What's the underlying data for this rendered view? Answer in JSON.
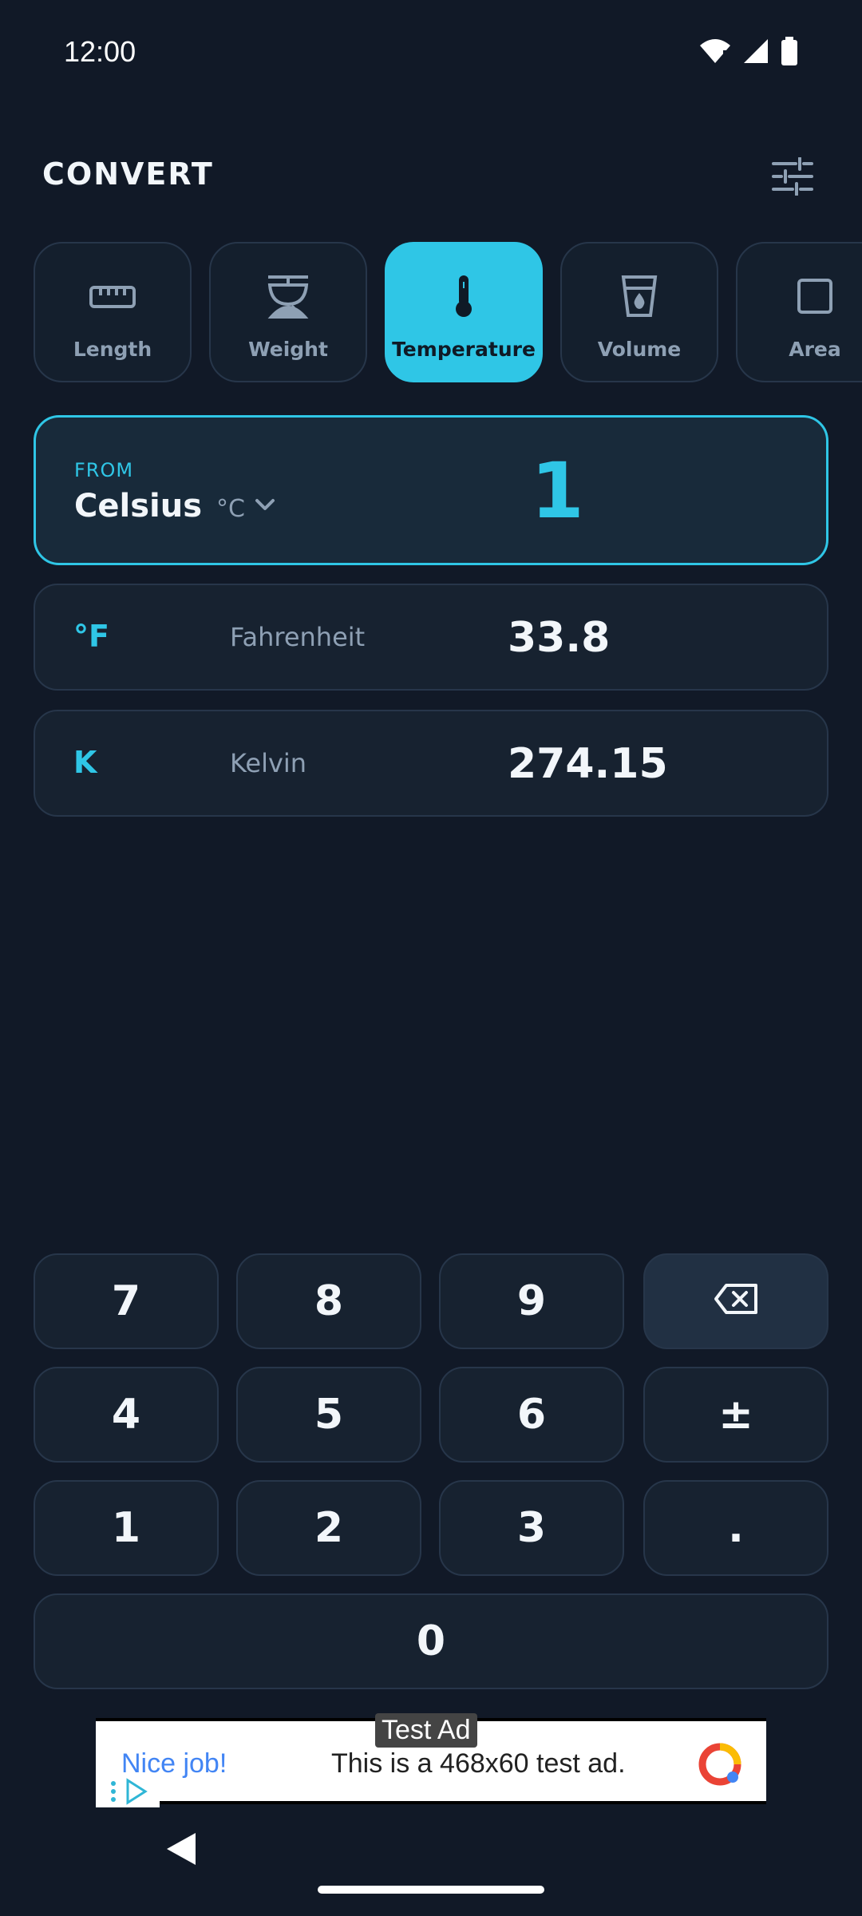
{
  "status_bar": {
    "time": "12:00"
  },
  "header": {
    "title": "CONVERT"
  },
  "categories": [
    {
      "label": "Length",
      "icon": "ruler-icon"
    },
    {
      "label": "Weight",
      "icon": "scale-icon"
    },
    {
      "label": "Temperature",
      "icon": "thermometer-icon",
      "active": true
    },
    {
      "label": "Volume",
      "icon": "cup-icon"
    },
    {
      "label": "Area",
      "icon": "square-icon"
    }
  ],
  "from": {
    "label": "FROM",
    "unit_name": "Celsius",
    "unit_symbol": "°C",
    "value": "1"
  },
  "results": [
    {
      "symbol": "°F",
      "name": "Fahrenheit",
      "value": "33.8"
    },
    {
      "symbol": "K",
      "name": "Kelvin",
      "value": "274.15"
    }
  ],
  "keypad": {
    "k7": "7",
    "k8": "8",
    "k9": "9",
    "k4": "4",
    "k5": "5",
    "k6": "6",
    "plusminus": "±",
    "k1": "1",
    "k2": "2",
    "k3": "3",
    "decimal": ".",
    "k0": "0"
  },
  "ad": {
    "tag": "Test Ad",
    "headline": "Nice job!",
    "body": "This is a 468x60 test ad."
  },
  "colors": {
    "background": "#111927",
    "accent": "#2fc6e6",
    "card": "#172230",
    "border": "#27364a"
  }
}
